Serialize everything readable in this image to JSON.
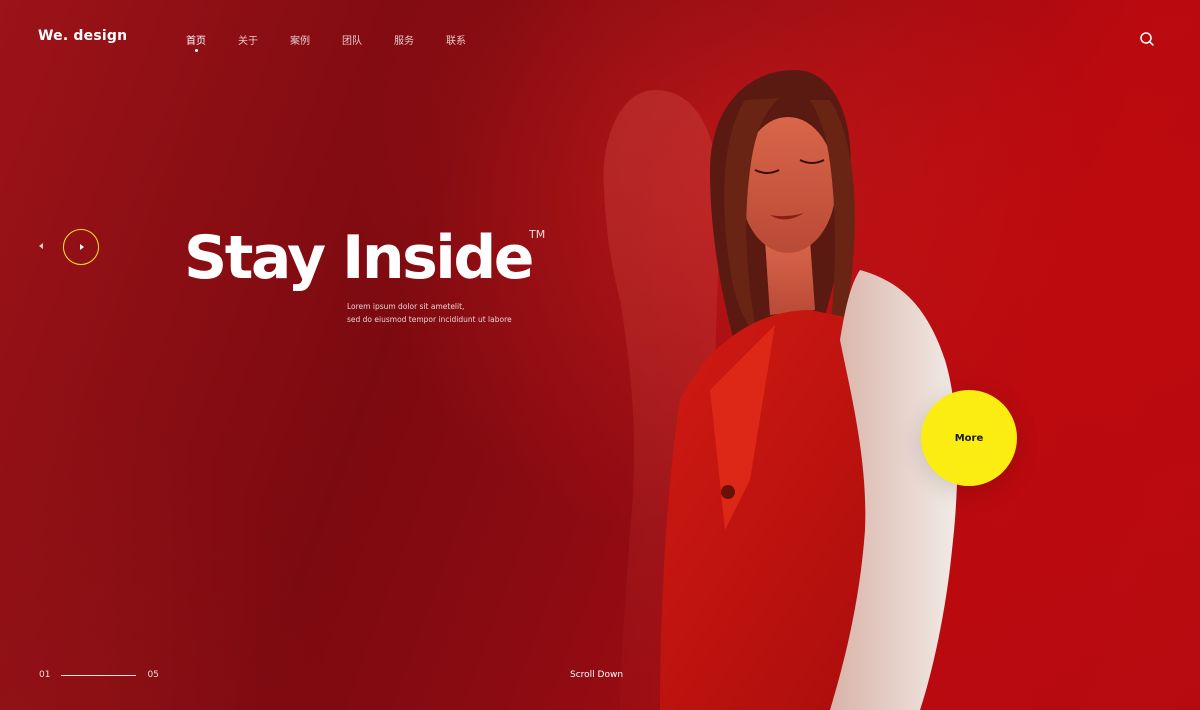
{
  "brand": {
    "logo_text": "We. design"
  },
  "nav": {
    "items": [
      {
        "label": "首页",
        "active": true
      },
      {
        "label": "关于",
        "active": false
      },
      {
        "label": "案例",
        "active": false
      },
      {
        "label": "团队",
        "active": false
      },
      {
        "label": "服务",
        "active": false
      },
      {
        "label": "联系",
        "active": false
      }
    ]
  },
  "header": {
    "search_icon": "search-icon"
  },
  "hero": {
    "title": "Stay Inside",
    "trademark": "TM",
    "description_line1": "Lorem ipsum dolor sit ametelit,",
    "description_line2": "sed do eiusmod tempor incididunt ut labore",
    "more_label": "More"
  },
  "slider": {
    "prev_icon": "triangle-left-icon",
    "play_icon": "play-icon",
    "current": "01",
    "total": "05",
    "progress": 1.0
  },
  "footer": {
    "scroll_label": "Scroll Down"
  },
  "colors": {
    "accent_yellow": "#fbec12",
    "background_red": "#9a0a0e",
    "text": "#ffffff"
  }
}
